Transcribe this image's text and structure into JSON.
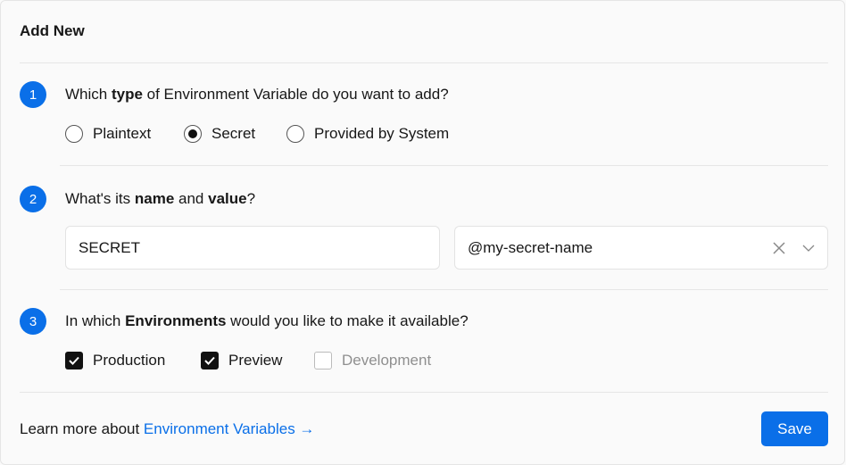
{
  "title": "Add New",
  "steps": [
    {
      "number": "1",
      "pre": "Which ",
      "bold": "type",
      "post": " of Environment Variable do you want to add?"
    },
    {
      "number": "2",
      "pre": "What's its ",
      "bold": "name",
      "mid": " and ",
      "bold2": "value",
      "post": "?"
    },
    {
      "number": "3",
      "pre": "In which ",
      "bold": "Environments",
      "post": " would you like to make it available?"
    }
  ],
  "types": [
    {
      "label": "Plaintext",
      "selected": false
    },
    {
      "label": "Secret",
      "selected": true
    },
    {
      "label": "Provided by System",
      "selected": false
    }
  ],
  "name_value": "SECRET",
  "secret_value": "@my-secret-name",
  "environments": [
    {
      "label": "Production",
      "checked": true
    },
    {
      "label": "Preview",
      "checked": true
    },
    {
      "label": "Development",
      "checked": false
    }
  ],
  "footer": {
    "text": "Learn more about ",
    "link": "Environment Variables →"
  },
  "save_label": "Save",
  "colors": {
    "accent": "#0a6fe8"
  }
}
